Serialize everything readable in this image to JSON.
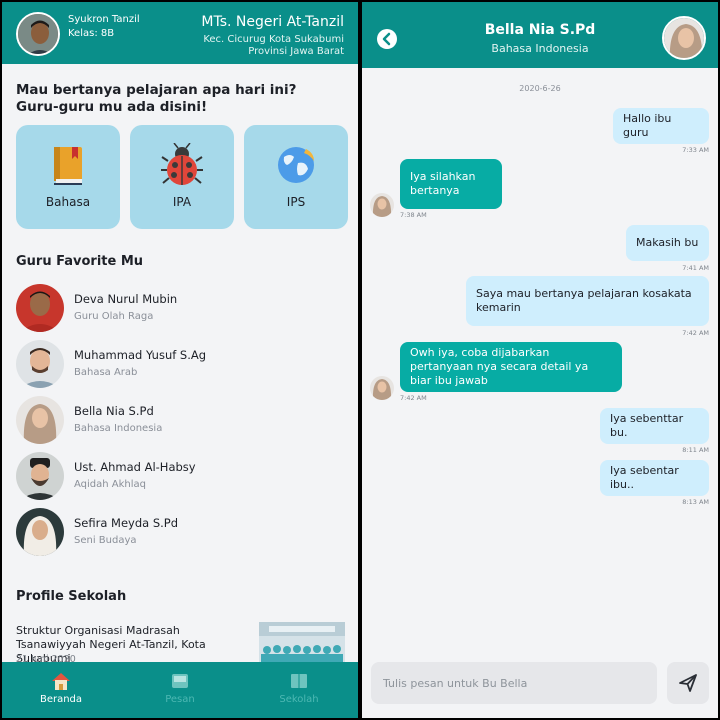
{
  "left": {
    "header": {
      "student_name": "Syukron Tanzil",
      "student_class": "Kelas: 8B",
      "school_name": "MTs. Negeri At-Tanzil",
      "school_address_1": "Kec. Cicurug Kota Sukabumi",
      "school_address_2": "Provinsi Jawa Barat"
    },
    "question_line_1": "Mau bertanya pelajaran apa hari ini?",
    "question_line_2": "Guru-guru mu ada disini!",
    "subjects": [
      {
        "label": "Bahasa",
        "icon": "book-icon"
      },
      {
        "label": "IPA",
        "icon": "ladybug-icon"
      },
      {
        "label": "IPS",
        "icon": "globe-icon"
      }
    ],
    "favorite_title": "Guru Favorite Mu",
    "teachers": [
      {
        "name": "Deva Nurul Mubin",
        "subject": "Guru Olah Raga"
      },
      {
        "name": "Muhammad Yusuf S.Ag",
        "subject": "Bahasa Arab"
      },
      {
        "name": "Bella Nia S.Pd",
        "subject": "Bahasa Indonesia"
      },
      {
        "name": "Ust. Ahmad Al-Habsy",
        "subject": "Aqidah Akhlaq"
      },
      {
        "name": "Sefira Meyda S.Pd",
        "subject": "Seni Budaya"
      }
    ],
    "profile_title": "Profile Sekolah",
    "news": {
      "title": "Struktur Organisasi Madrasah Tsanawiyyah Negeri At-Tanzil, Kota Sukabumi",
      "date": "21 Juni 2020"
    },
    "nav": [
      {
        "label": "Beranda",
        "icon": "home-icon",
        "active": true
      },
      {
        "label": "Pesan",
        "icon": "inbox-icon",
        "active": false
      },
      {
        "label": "Sekolah",
        "icon": "school-book-icon",
        "active": false
      }
    ]
  },
  "right": {
    "header": {
      "name": "Bella Nia S.Pd",
      "subject": "Bahasa Indonesia"
    },
    "date": "2020-6-26",
    "messages": [
      {
        "dir": "out",
        "text": "Hallo ibu guru",
        "time": "7:33 AM"
      },
      {
        "dir": "in",
        "text": "Iya silahkan bertanya",
        "time": "7:38 AM"
      },
      {
        "dir": "out",
        "text": "Makasih bu",
        "time": "7:41 AM"
      },
      {
        "dir": "out",
        "text": "Saya mau bertanya pelajaran kosakata kemarin",
        "time": "7:42 AM"
      },
      {
        "dir": "in",
        "text": "Owh iya, coba dijabarkan pertanyaan nya secara detail ya biar ibu jawab",
        "time": "7:42 AM"
      },
      {
        "dir": "out",
        "text": "Iya sebenttar bu.",
        "time": "8:11 AM"
      },
      {
        "dir": "out",
        "text": "Iya sebentar ibu..",
        "time": "8:13 AM"
      }
    ],
    "input_placeholder": "Tulis pesan untuk Bu Bella"
  },
  "colors": {
    "teal": "#0a8f8a",
    "incoming_bubble": "#07aca4",
    "outgoing_bubble": "#cfeefd",
    "subject_card": "#a6d9ea"
  }
}
